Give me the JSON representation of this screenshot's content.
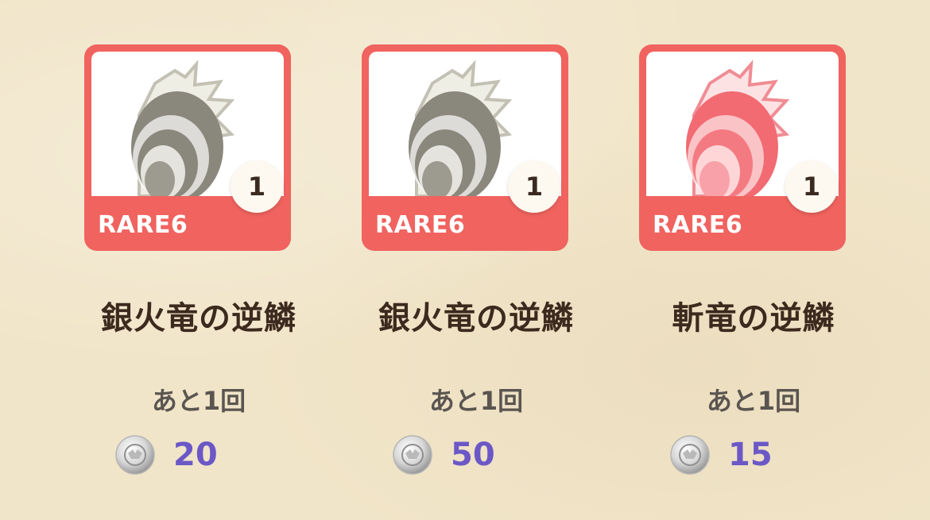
{
  "items": [
    {
      "rarity": "RARE6",
      "quantity": "1",
      "name": "銀火竜の逆鱗",
      "remaining": "あと1回",
      "price": "20",
      "icon": "silver-dragon-scale-icon",
      "color": "#8a877c"
    },
    {
      "rarity": "RARE6",
      "quantity": "1",
      "name": "銀火竜の逆鱗",
      "remaining": "あと1回",
      "price": "50",
      "icon": "silver-dragon-scale-icon",
      "color": "#8a877c"
    },
    {
      "rarity": "RARE6",
      "quantity": "1",
      "name": "斬竜の逆鱗",
      "remaining": "あと1回",
      "price": "15",
      "icon": "red-dragon-scale-icon",
      "color": "#f26a72"
    }
  ],
  "colors": {
    "background": "#f1e5c9",
    "card_border": "#f0635f",
    "price": "#6b58c6",
    "name_text": "#3c2a1e"
  },
  "currency_icon": "silver-coin-icon"
}
